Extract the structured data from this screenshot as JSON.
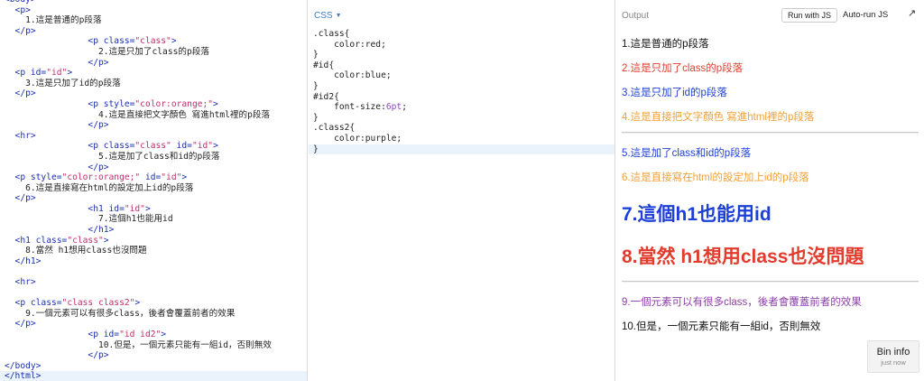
{
  "colors": {
    "html_tag": "#1a2fb0",
    "html_attr_value": "#c02e6c",
    "css_number": "#8a49c4",
    "red": "#e33b2e",
    "blue": "#1c3fd8",
    "orange": "#f0a13a",
    "purple": "#8c3fa8",
    "pane_accent": "#3e7dc5"
  },
  "html_panel": {
    "lines": [
      [
        {
          "t": "tag",
          "v": "<body>"
        }
      ],
      [
        {
          "t": "tag",
          "v": "  <p>"
        }
      ],
      [
        {
          "t": "txt",
          "v": "    1.這是普通的p段落"
        }
      ],
      [
        {
          "t": "tag",
          "v": "  </p>"
        }
      ],
      [
        {
          "t": "tag",
          "v": "                <p class="
        },
        {
          "t": "str",
          "v": "\"class\""
        },
        {
          "t": "tag",
          "v": ">"
        }
      ],
      [
        {
          "t": "txt",
          "v": "                  2.這是只加了class的p段落"
        }
      ],
      [
        {
          "t": "tag",
          "v": "                </p>"
        }
      ],
      [
        {
          "t": "tag",
          "v": "  <p id="
        },
        {
          "t": "str",
          "v": "\"id\""
        },
        {
          "t": "tag",
          "v": ">"
        }
      ],
      [
        {
          "t": "txt",
          "v": "    3.這是只加了id的p段落"
        }
      ],
      [
        {
          "t": "tag",
          "v": "  </p>"
        }
      ],
      [
        {
          "t": "tag",
          "v": "                <p style="
        },
        {
          "t": "str",
          "v": "\"color:orange;\""
        },
        {
          "t": "tag",
          "v": ">"
        }
      ],
      [
        {
          "t": "txt",
          "v": "                  4.這是直接把文字顏色 寫進html裡的p段落"
        }
      ],
      [
        {
          "t": "tag",
          "v": "                </p>"
        }
      ],
      [
        {
          "t": "tag",
          "v": "  <hr>"
        }
      ],
      [
        {
          "t": "tag",
          "v": "                <p class="
        },
        {
          "t": "str",
          "v": "\"class\""
        },
        {
          "t": "tag",
          "v": " id="
        },
        {
          "t": "str",
          "v": "\"id\""
        },
        {
          "t": "tag",
          "v": ">"
        }
      ],
      [
        {
          "t": "txt",
          "v": "                  5.這是加了class和id的p段落"
        }
      ],
      [
        {
          "t": "tag",
          "v": "                </p>"
        }
      ],
      [
        {
          "t": "tag",
          "v": "  <p style="
        },
        {
          "t": "str",
          "v": "\"color:orange;\""
        },
        {
          "t": "tag",
          "v": " id="
        },
        {
          "t": "str",
          "v": "\"id\""
        },
        {
          "t": "tag",
          "v": ">"
        }
      ],
      [
        {
          "t": "txt",
          "v": "    6.這是直接寫在html的設定加上id的p段落"
        }
      ],
      [
        {
          "t": "tag",
          "v": "  </p>"
        }
      ],
      [
        {
          "t": "tag",
          "v": "                <h1 id="
        },
        {
          "t": "str",
          "v": "\"id\""
        },
        {
          "t": "tag",
          "v": ">"
        }
      ],
      [
        {
          "t": "txt",
          "v": "                  7.這個h1也能用id"
        }
      ],
      [
        {
          "t": "tag",
          "v": "                </h1>"
        }
      ],
      [
        {
          "t": "tag",
          "v": "  <h1 class="
        },
        {
          "t": "str",
          "v": "\"class\""
        },
        {
          "t": "tag",
          "v": ">"
        }
      ],
      [
        {
          "t": "txt",
          "v": "    8.當然 h1想用class也沒問題"
        }
      ],
      [
        {
          "t": "tag",
          "v": "  </h1>"
        }
      ],
      [
        {
          "t": "txt",
          "v": ""
        }
      ],
      [
        {
          "t": "tag",
          "v": "  <hr>"
        }
      ],
      [
        {
          "t": "txt",
          "v": ""
        }
      ],
      [
        {
          "t": "tag",
          "v": "  <p class="
        },
        {
          "t": "str",
          "v": "\"class class2\""
        },
        {
          "t": "tag",
          "v": ">"
        }
      ],
      [
        {
          "t": "txt",
          "v": "    9.一個元素可以有很多class，後者會覆蓋前者的效果"
        }
      ],
      [
        {
          "t": "tag",
          "v": "  </p>"
        }
      ],
      [
        {
          "t": "tag",
          "v": "                <p id="
        },
        {
          "t": "str",
          "v": "\"id id2\""
        },
        {
          "t": "tag",
          "v": ">"
        }
      ],
      [
        {
          "t": "txt",
          "v": "                  10.但是，一個元素只能有一組id，否則無效"
        }
      ],
      [
        {
          "t": "tag",
          "v": "                </p>"
        }
      ],
      [
        {
          "t": "tag",
          "v": "</body>"
        }
      ],
      [
        {
          "t": "tag",
          "v": "</html>"
        }
      ]
    ],
    "active_line": 36
  },
  "css_panel": {
    "header_label": "CSS",
    "lines": [
      [
        {
          "t": "txt",
          "v": ".class{"
        }
      ],
      [
        {
          "t": "txt",
          "v": "    color:red;"
        }
      ],
      [
        {
          "t": "txt",
          "v": "}"
        }
      ],
      [
        {
          "t": "txt",
          "v": "#id{"
        }
      ],
      [
        {
          "t": "txt",
          "v": "    color:blue;"
        }
      ],
      [
        {
          "t": "txt",
          "v": "}"
        }
      ],
      [
        {
          "t": "txt",
          "v": "#id2{"
        }
      ],
      [
        {
          "t": "txt",
          "v": "    font-size:"
        },
        {
          "t": "num",
          "v": "6pt"
        },
        {
          "t": "txt",
          "v": ";"
        }
      ],
      [
        {
          "t": "txt",
          "v": "}"
        }
      ],
      [
        {
          "t": "txt",
          "v": ".class2{"
        }
      ],
      [
        {
          "t": "txt",
          "v": "    color:purple;"
        }
      ],
      [
        {
          "t": "txt",
          "v": "}"
        }
      ]
    ],
    "active_line": 11
  },
  "output_panel": {
    "header_label": "Output",
    "run_button_label": "Run with JS",
    "autorun_label": "Auto-run JS",
    "expand_icon": "expand-arrow-icon",
    "p1": "1.這是普通的p段落",
    "p2": "2.這是只加了class的p段落",
    "p3": "3.這是只加了id的p段落",
    "p4": "4.這是直接把文字顏色 寫進html裡的p段落",
    "p5": "5.這是加了class和id的p段落",
    "p6": "6.這是直接寫在html的設定加上id的p段落",
    "h7": "7.這個h1也能用id",
    "h8": "8.當然 h1想用class也沒問題",
    "p9": "9.一個元素可以有很多class，後者會覆蓋前者的效果",
    "p10": "10.但是，一個元素只能有一組id，否則無效"
  },
  "bin_info": {
    "title": "Bin info",
    "subtitle": "just now"
  }
}
